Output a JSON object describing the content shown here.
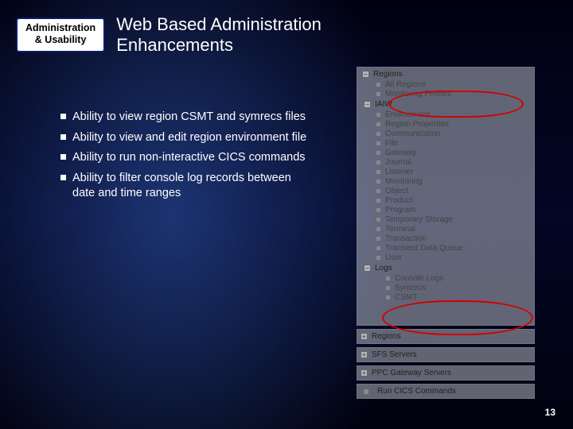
{
  "header": {
    "badge_line1": "Administration",
    "badge_line2": "& Usability",
    "title_line1": "Web Based Administration",
    "title_line2": "Enhancements"
  },
  "bullets": [
    "Ability to view region CSMT and symrecs files",
    "Ability to view and edit region environment file",
    "Ability to run non-interactive CICS commands",
    "Ability to filter console log records between date and time ranges"
  ],
  "tree": {
    "top_header": "Regions",
    "top_items": [
      "All Regions",
      "Monitoring Profiles"
    ],
    "region_header": "IAIW",
    "region_items": [
      "Environment",
      "Region Properties",
      "Communication",
      "File",
      "Gateway",
      "Journal",
      "Listener",
      "Monitoring",
      "Object",
      "Product",
      "Program",
      "Temporary Storage",
      "Terminal",
      "Transaction",
      "Transient Data Queue",
      "User"
    ],
    "logs_header": "Logs",
    "logs_items": [
      "Console Logs",
      "Symrecs",
      "CSMT"
    ]
  },
  "mini_panels": [
    "Regions",
    "SFS Servers",
    "PPC Gateway Servers",
    "Run CICS Commands"
  ],
  "page_number": "13"
}
